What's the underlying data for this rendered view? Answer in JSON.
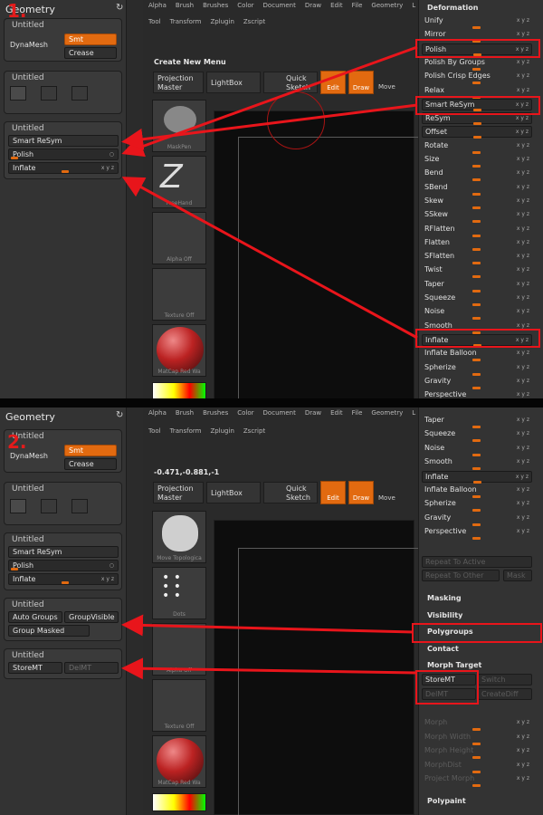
{
  "colors": {
    "accent": "#e26a10",
    "annotation": "#e8151b",
    "panel_bg": "#333333"
  },
  "panel1": {
    "step": "1.",
    "geometry_title": "Geometry",
    "menu": [
      "Alpha",
      "Brush",
      "Brushes",
      "Color",
      "Document",
      "Draw",
      "Edit",
      "File",
      "Geometry",
      "L"
    ],
    "menu2": [
      "Tool",
      "Transform",
      "Zplugin",
      "Zscript"
    ],
    "create_new_menu": "Create New Menu",
    "dynamesh_group": {
      "title": "Untitled",
      "label": "DynaMesh",
      "smt": "Smt",
      "crease": "Crease"
    },
    "empty_group": {
      "title": "Untitled"
    },
    "deform_group": {
      "title": "Untitled",
      "smart_resym": "Smart ReSym",
      "polish": "Polish",
      "inflate": "Inflate"
    },
    "tools": {
      "projection_master": "Projection Master",
      "lightbox": "LightBox",
      "quick_sketch": "Quick Sketch",
      "edit": "Edit",
      "draw": "Draw",
      "move": "Move"
    },
    "thumbs": [
      "MaskPen",
      "FreeHand",
      "Alpha Off",
      "Texture Off",
      "MatCap Red Wa"
    ],
    "deformation": {
      "header": "Deformation",
      "items": [
        "Unify",
        "Mirror",
        "Polish",
        "Polish By Groups",
        "Polish Crisp Edges",
        "Relax",
        "Smart ReSym",
        "ReSym",
        "Offset",
        "Rotate",
        "Size",
        "Bend",
        "SBend",
        "Skew",
        "SSkew",
        "RFlatten",
        "Flatten",
        "SFlatten",
        "Twist",
        "Taper",
        "Squeeze",
        "Noise",
        "Smooth",
        "Inflate",
        "Inflate Balloon",
        "Spherize",
        "Gravity",
        "Perspective"
      ]
    }
  },
  "panel2": {
    "step": "2.",
    "geometry_title": "Geometry",
    "coords": "-0.471,-0.881,-1",
    "dynamesh_group": {
      "title": "Untitled",
      "label": "DynaMesh",
      "smt": "Smt",
      "crease": "Crease"
    },
    "empty_group": {
      "title": "Untitled"
    },
    "deform_group": {
      "title": "Untitled",
      "smart_resym": "Smart ReSym",
      "polish": "Polish",
      "inflate": "Inflate"
    },
    "groups_group": {
      "title": "Untitled",
      "auto_groups": "Auto Groups",
      "group_visible": "GroupVisible",
      "group_masked": "Group Masked"
    },
    "morph_group": {
      "title": "Untitled",
      "storemt": "StoreMT",
      "delmt": "DelMT"
    },
    "thumbs": [
      "Move Topologica",
      "Dots",
      "Alpha Off",
      "Texture Off",
      "MatCap Red Wa"
    ],
    "deformation_items": [
      "Taper",
      "Squeeze",
      "Noise",
      "Smooth",
      "Inflate",
      "Inflate Balloon",
      "Spherize",
      "Gravity",
      "Perspective"
    ],
    "repeat_active": "Repeat To Active",
    "repeat_other": "Repeat To Other",
    "mask_btn": "Mask",
    "sections": [
      "Masking",
      "Visibility",
      "Polygroups",
      "Contact",
      "Morph Target"
    ],
    "morph": {
      "storemt": "StoreMT",
      "switch": "Switch",
      "delmt": "DelMT",
      "createdifff": "CreateDiff",
      "items": [
        "Morph",
        "Morph Width",
        "Morph Height",
        "MorphDist",
        "Project Morph"
      ]
    },
    "polypaint": "Polypaint"
  }
}
